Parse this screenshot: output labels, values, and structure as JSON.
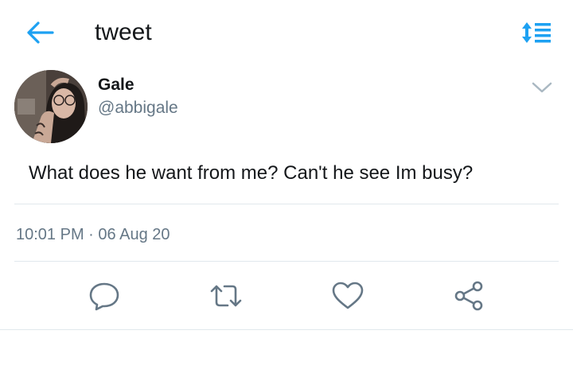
{
  "header": {
    "title": "tweet",
    "back_icon": "arrow-left-icon",
    "sort_icon": "sort-list-icon",
    "accent_color": "#1da1f2"
  },
  "tweet": {
    "author": {
      "display_name": "Gale",
      "handle": "@abbigale",
      "avatar": "avatar-photo"
    },
    "menu_icon": "chevron-down-icon",
    "text": "What does he want from me? Can't he see Im busy?",
    "time": "10:01 PM",
    "separator": "·",
    "date": "06 Aug 20"
  },
  "actions": [
    {
      "name": "reply",
      "icon": "reply-icon"
    },
    {
      "name": "retweet",
      "icon": "retweet-icon"
    },
    {
      "name": "like",
      "icon": "heart-icon"
    },
    {
      "name": "share",
      "icon": "share-icon"
    }
  ]
}
